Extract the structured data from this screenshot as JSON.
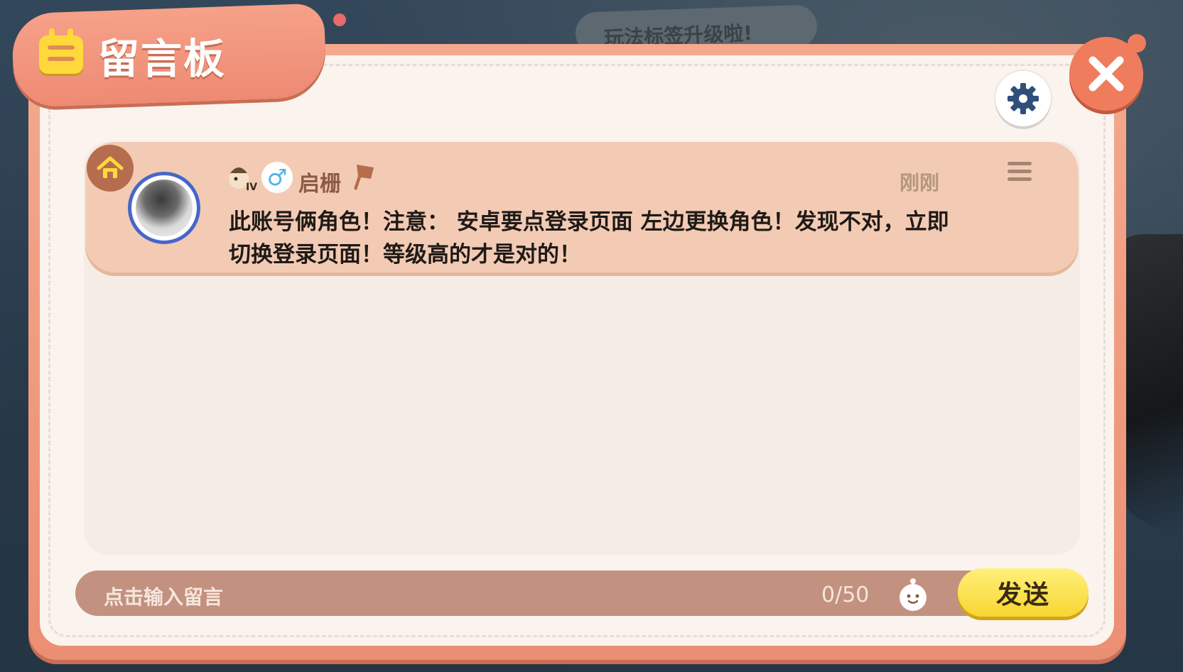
{
  "window": {
    "title": "留言板",
    "background_banner_text": "玩法标签升级啦!"
  },
  "message": {
    "username": "启栅",
    "gender_symbol": "♂",
    "level_badge": "IV",
    "timestamp": "刚刚",
    "text": "此账号俩角色！注意： 安卓要点登录页面 左边更换角色！发现不对，立即切换登录页面！等级高的才是对的！"
  },
  "input": {
    "placeholder": "点击输入留言",
    "char_count": "0/50"
  },
  "buttons": {
    "send_label": "发送"
  },
  "icons": {
    "title": "notepad-icon",
    "close": "close-icon",
    "settings": "gear-icon",
    "home": "home-icon",
    "menu": "menu-icon",
    "emoji": "emoji-icon",
    "level": "level-badge-icon",
    "tag": "tag-icon"
  },
  "colors": {
    "frame": "#ee8a73",
    "panel": "#faf3ee",
    "card": "#f3cbb4",
    "send": "#f8d531",
    "input_bar": "#c3917f"
  }
}
